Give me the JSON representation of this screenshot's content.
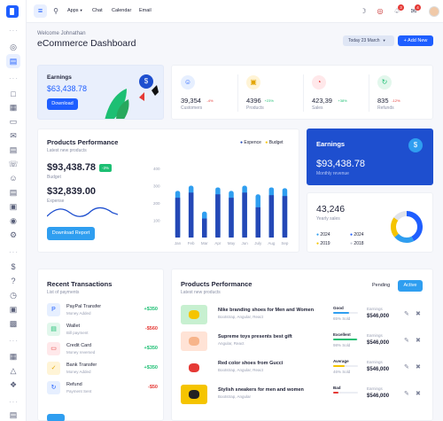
{
  "topbar": {
    "nav": [
      "Apps",
      "Chat",
      "Calendar",
      "Email"
    ],
    "notif_count_1": "3",
    "notif_count_2": "4"
  },
  "header": {
    "welcome": "Welcome Johnathan",
    "title": "eCommerce Dashboard",
    "date_button": "Today 23 March",
    "add_button": "+ Add New"
  },
  "earnings_card": {
    "title": "Earnings",
    "value": "$63,438.78",
    "button": "Download"
  },
  "stats": [
    {
      "value": "39,354",
      "change": "-4%",
      "label": "Customers",
      "color": "#1e5eff",
      "bg": "#e6efff",
      "change_color": "#e53935",
      "icon": "users-icon",
      "glyph": "☺"
    },
    {
      "value": "4396",
      "change": "+23%",
      "label": "Products",
      "color": "#e3a400",
      "bg": "#fff4d6",
      "change_color": "#1dbf73",
      "icon": "box-icon",
      "glyph": "▣"
    },
    {
      "value": "423,39",
      "change": "+38%",
      "label": "Sales",
      "color": "#e53935",
      "bg": "#ffe8ea",
      "change_color": "#1dbf73",
      "icon": "chart-icon",
      "glyph": "◔"
    },
    {
      "value": "835",
      "change": "-12%",
      "label": "Refunds",
      "color": "#1dbf73",
      "bg": "#e2f7ec",
      "change_color": "#e53935",
      "icon": "refresh-icon",
      "glyph": "↻"
    }
  ],
  "performance": {
    "title": "Products Performance",
    "subtitle": "Latest new products",
    "legend_expense": "Expence",
    "legend_budget": "Budget",
    "budget_value": "$93,438.78",
    "budget_change": "-3%",
    "budget_label": "Budget",
    "expense_value": "$32,839.00",
    "expense_label": "Expense",
    "button": "Download Report"
  },
  "chart_data": {
    "type": "bar",
    "categories": [
      "Jan",
      "Feb",
      "Mar",
      "Apr",
      "May",
      "Jun",
      "July",
      "Aug",
      "Sep"
    ],
    "ylim": [
      0,
      400
    ],
    "yticks": [
      "400",
      "300",
      "200",
      "100"
    ],
    "series": [
      {
        "name": "Expence",
        "color": "#2448b6",
        "values": [
          230,
          260,
          110,
          250,
          230,
          260,
          175,
          245,
          240
        ]
      },
      {
        "name": "Budget",
        "color": "#2f9ef0",
        "values": [
          270,
          300,
          150,
          290,
          270,
          300,
          250,
          290,
          285
        ]
      }
    ]
  },
  "earnings_blue": {
    "title": "Earnings",
    "value": "$93,438.78",
    "label": "Monthly revenue"
  },
  "yearly": {
    "value": "43,246",
    "label": "Yearly sales",
    "legend": [
      {
        "year": "2024",
        "color": "#2f9ef0"
      },
      {
        "year": "2024",
        "color": "#1e5eff"
      },
      {
        "year": "2019",
        "color": "#f5c400"
      },
      {
        "year": "2018",
        "color": "#e0e3ea"
      }
    ]
  },
  "transactions": {
    "title": "Recent Transactions",
    "subtitle": "List of payments",
    "items": [
      {
        "name": "PayPal Transfer",
        "sub": "Money Added",
        "amount": "+$350",
        "amount_color": "#1dbf73",
        "bg": "#e6efff",
        "color": "#1e5eff",
        "icon": "paypal-icon",
        "glyph": "P"
      },
      {
        "name": "Wallet",
        "sub": "Bill payment",
        "amount": "-$560",
        "amount_color": "#e53935",
        "bg": "#e2f7ec",
        "color": "#1dbf73",
        "icon": "wallet-icon",
        "glyph": "▤"
      },
      {
        "name": "Credit Card",
        "sub": "Money reversed",
        "amount": "+$350",
        "amount_color": "#1dbf73",
        "bg": "#ffe8ea",
        "color": "#e53935",
        "icon": "credit-card-icon",
        "glyph": "▭"
      },
      {
        "name": "Bank Transfer",
        "sub": "Money Added",
        "amount": "+$350",
        "amount_color": "#1dbf73",
        "bg": "#fff4d6",
        "color": "#e3a400",
        "icon": "bank-icon",
        "glyph": "✓"
      },
      {
        "name": "Refund",
        "sub": "Payment Sent",
        "amount": "-$50",
        "amount_color": "#e53935",
        "bg": "#e6efff",
        "color": "#1e5eff",
        "icon": "refund-icon",
        "glyph": "↻"
      }
    ]
  },
  "products": {
    "title": "Products Performance",
    "subtitle": "Latest new products",
    "tab_pending": "Pending",
    "tab_active": "Active",
    "earnings_label": "Earnings",
    "items": [
      {
        "name": "Nike branding shoes for Men and Women",
        "sub": "Bootstrap, Angular, React",
        "status": "Good",
        "bar_color": "#2f9ef0",
        "sold_pct": 65,
        "sold": "65% Sold",
        "earnings": "$546,000",
        "img": "#c7f0d0",
        "img2": "#f5c400"
      },
      {
        "name": "Supreme toys presents best gift",
        "sub": "Angular, React",
        "status": "Excellent",
        "bar_color": "#1dbf73",
        "sold_pct": 98,
        "sold": "98% Sold",
        "earnings": "$546,000",
        "img": "#ffe3d6",
        "img2": "#f7b48a"
      },
      {
        "name": "Red color shoes from Gucci",
        "sub": "Bootstrap, Angular, React",
        "status": "Average",
        "bar_color": "#f5c400",
        "sold_pct": 46,
        "sold": "46% Sold",
        "earnings": "$546,000",
        "img": "#ffffff",
        "img2": "#e53935"
      },
      {
        "name": "Stylish sneakers for men and women",
        "sub": "Bootstrap, Angular",
        "status": "Bad",
        "bar_color": "#e53935",
        "sold_pct": 20,
        "sold": "",
        "earnings": "$546,000",
        "img": "#f5c400",
        "img2": "#222222"
      }
    ]
  },
  "colors": {
    "accent": "#1e5eff",
    "blue_card": "#1e4fcf"
  }
}
